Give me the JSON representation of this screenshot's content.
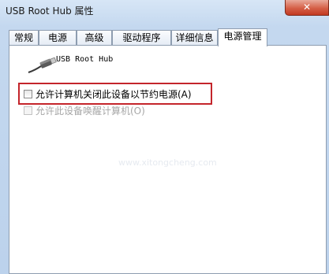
{
  "window": {
    "title": "USB Root Hub 属性",
    "close_glyph": "✕"
  },
  "tabs": [
    {
      "label": "常规"
    },
    {
      "label": "电源"
    },
    {
      "label": "高级"
    },
    {
      "label": "驱动程序"
    },
    {
      "label": "详细信息"
    },
    {
      "label": "电源管理",
      "active": true
    }
  ],
  "device": {
    "name": "USB Root Hub",
    "icon": "usb-cable-icon"
  },
  "options": [
    {
      "label": "允许计算机关闭此设备以节约电源(A)",
      "checked": false,
      "enabled": true
    },
    {
      "label": "允许此设备唤醒计算机(O)",
      "checked": false,
      "enabled": false
    }
  ],
  "watermark": "www.xitongcheng.com",
  "colors": {
    "highlight_border": "#c4252b",
    "close_button": "#d55f47"
  }
}
